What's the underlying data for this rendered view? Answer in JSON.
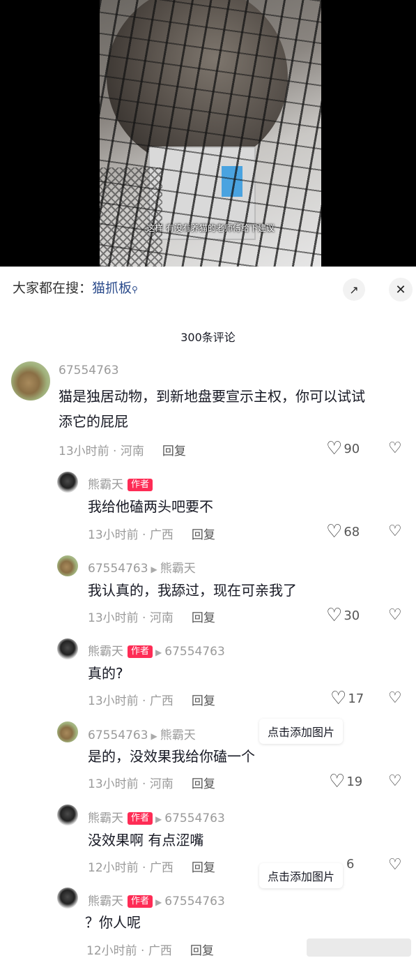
{
  "video": {
    "subtitle": "这样 有没有养猫的老师傅给下建议"
  },
  "search": {
    "prefix": "大家都在搜：",
    "keyword": "猫抓板",
    "search_icon": "search-icon",
    "expand_icon": "expand-icon",
    "close_icon": "close-icon",
    "close_label": "✕"
  },
  "comments_count": "300条评论",
  "comments": [
    {
      "user": "67554763",
      "avatar": "dog",
      "text_line1": "猫是独居动物，到新地盘要宣示主权，你可以试试",
      "text_line2": "添它的屁屁",
      "meta": "13小时前 · 河南",
      "reply": "回复",
      "likes": "90"
    },
    {
      "user": "熊霸天",
      "tag": "作者",
      "avatar": "bear",
      "text": "我给他磕两头吧要不",
      "meta": "13小时前 · 广西",
      "reply": "回复",
      "likes": "68"
    },
    {
      "user": "67554763",
      "to": "熊霸天",
      "avatar": "dog",
      "text": "我认真的，我舔过，现在可亲我了",
      "meta": "13小时前 · 河南",
      "reply": "回复",
      "likes": "30"
    },
    {
      "user": "熊霸天",
      "tag": "作者",
      "to": "67554763",
      "avatar": "bear",
      "text": "真的?",
      "meta": "13小时前 · 广西",
      "reply": "回复",
      "likes": "17"
    },
    {
      "user": "67554763",
      "to": "熊霸天",
      "avatar": "dog",
      "text": "是的，没效果我给你磕一个",
      "meta": "13小时前 · 河南",
      "reply": "回复",
      "likes": "19"
    },
    {
      "user": "熊霸天",
      "tag": "作者",
      "to": "67554763",
      "avatar": "bear",
      "text": "没效果啊 有点涩嘴",
      "meta": "12小时前 · 广西",
      "reply": "回复",
      "likes": "6"
    },
    {
      "user": "熊霸天",
      "tag": "作者",
      "to": "67554763",
      "avatar": "bear",
      "text": "？你人呢",
      "meta": "12小时前 · 广西",
      "reply": "回复",
      "likes": ""
    }
  ],
  "toasts": [
    "点击添加图片",
    "点击添加图片"
  ],
  "icons": {
    "like": "heart-icon",
    "dislike": "broken-heart-icon"
  }
}
